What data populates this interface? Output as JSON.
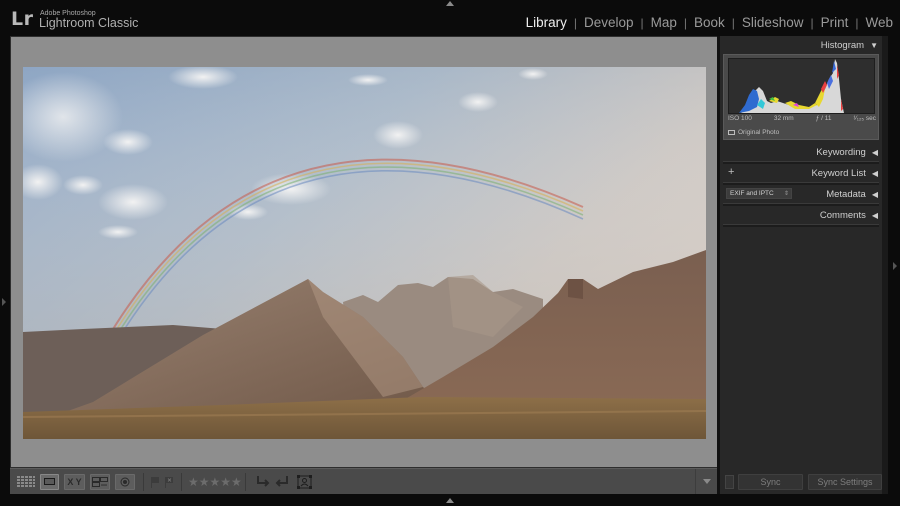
{
  "app": {
    "logo": "Lr",
    "brand_small": "Adobe Photoshop",
    "brand_name": "Lightroom Classic"
  },
  "modules": [
    {
      "label": "Library",
      "active": true
    },
    {
      "label": "Develop",
      "active": false
    },
    {
      "label": "Map",
      "active": false
    },
    {
      "label": "Book",
      "active": false
    },
    {
      "label": "Slideshow",
      "active": false
    },
    {
      "label": "Print",
      "active": false
    },
    {
      "label": "Web",
      "active": false
    }
  ],
  "module_separator": "|",
  "right_panel": {
    "histogram": {
      "title": "Histogram",
      "arrow": "▼",
      "iso": "ISO 100",
      "focal_length": "32 mm",
      "aperture": "ƒ / 11",
      "shutter": "¹⁄₁₂₅ sec",
      "original_photo_label": "Original Photo"
    },
    "panels": [
      {
        "title": "Keywording",
        "arrow": "◀"
      },
      {
        "title": "Keyword List",
        "arrow": "◀",
        "left_control": "+"
      },
      {
        "title": "Metadata",
        "arrow": "◀",
        "preset": "EXIF and IPTC",
        "preset_arrows": "⇕"
      },
      {
        "title": "Comments",
        "arrow": "◀"
      }
    ],
    "sync_label": "Sync",
    "sync_settings_label": "Sync Settings"
  },
  "toolbar": {
    "compare_label": "X Y",
    "rating_stars": "★★★★★",
    "rating_value": 0
  },
  "colors": {
    "active_module": "#f0f0f0",
    "inactive_module": "#9a9a9a",
    "view_background": "#8e8e8e",
    "panel_background": "#282828"
  }
}
